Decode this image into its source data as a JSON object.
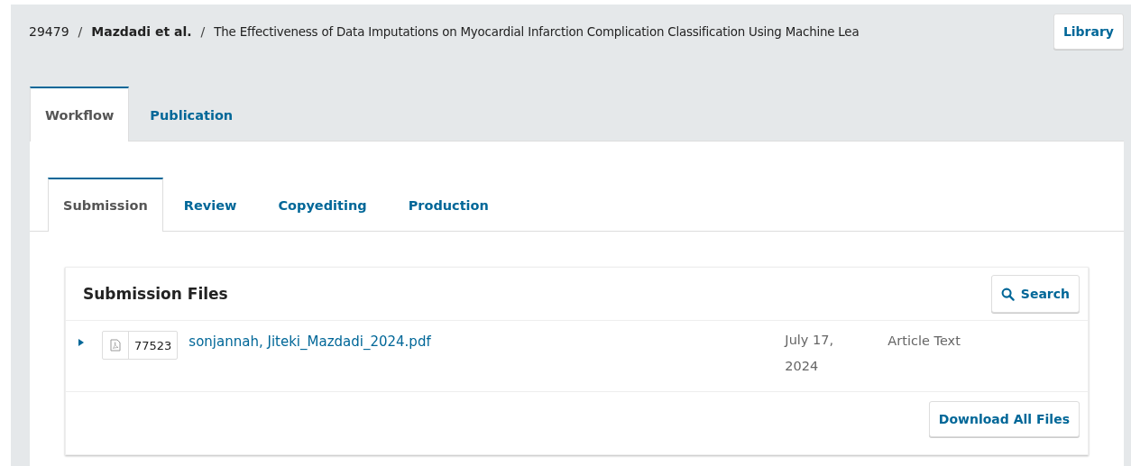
{
  "breadcrumb": [
    {
      "kind": "id",
      "text": "29479"
    },
    {
      "kind": "separator",
      "text": "/"
    },
    {
      "kind": "authors",
      "text": "Mazdadi et al."
    },
    {
      "kind": "separator",
      "text": "/"
    },
    {
      "kind": "title",
      "text": "The Effectiveness of Data Imputations on Myocardial Infarction Complication Classification Using Machine Lea"
    }
  ],
  "library_button": "Library",
  "tabs": [
    {
      "label": "Workflow",
      "selected": true
    },
    {
      "label": "Publication",
      "selected": false
    }
  ],
  "stage_tabs": [
    {
      "label": "Submission",
      "selected": true
    },
    {
      "label": "Review",
      "selected": false
    },
    {
      "label": "Copyediting",
      "selected": false
    },
    {
      "label": "Production",
      "selected": false
    }
  ],
  "files_panel": {
    "title": "Submission Files",
    "search_button": "Search",
    "files": [
      {
        "expanded": false,
        "id": "77523",
        "name": "sonjannah, Jiteki_Mazdadi_2024.pdf",
        "date": "July 17, 2024",
        "type": "Article Text"
      }
    ],
    "download_button": "Download All Files"
  }
}
